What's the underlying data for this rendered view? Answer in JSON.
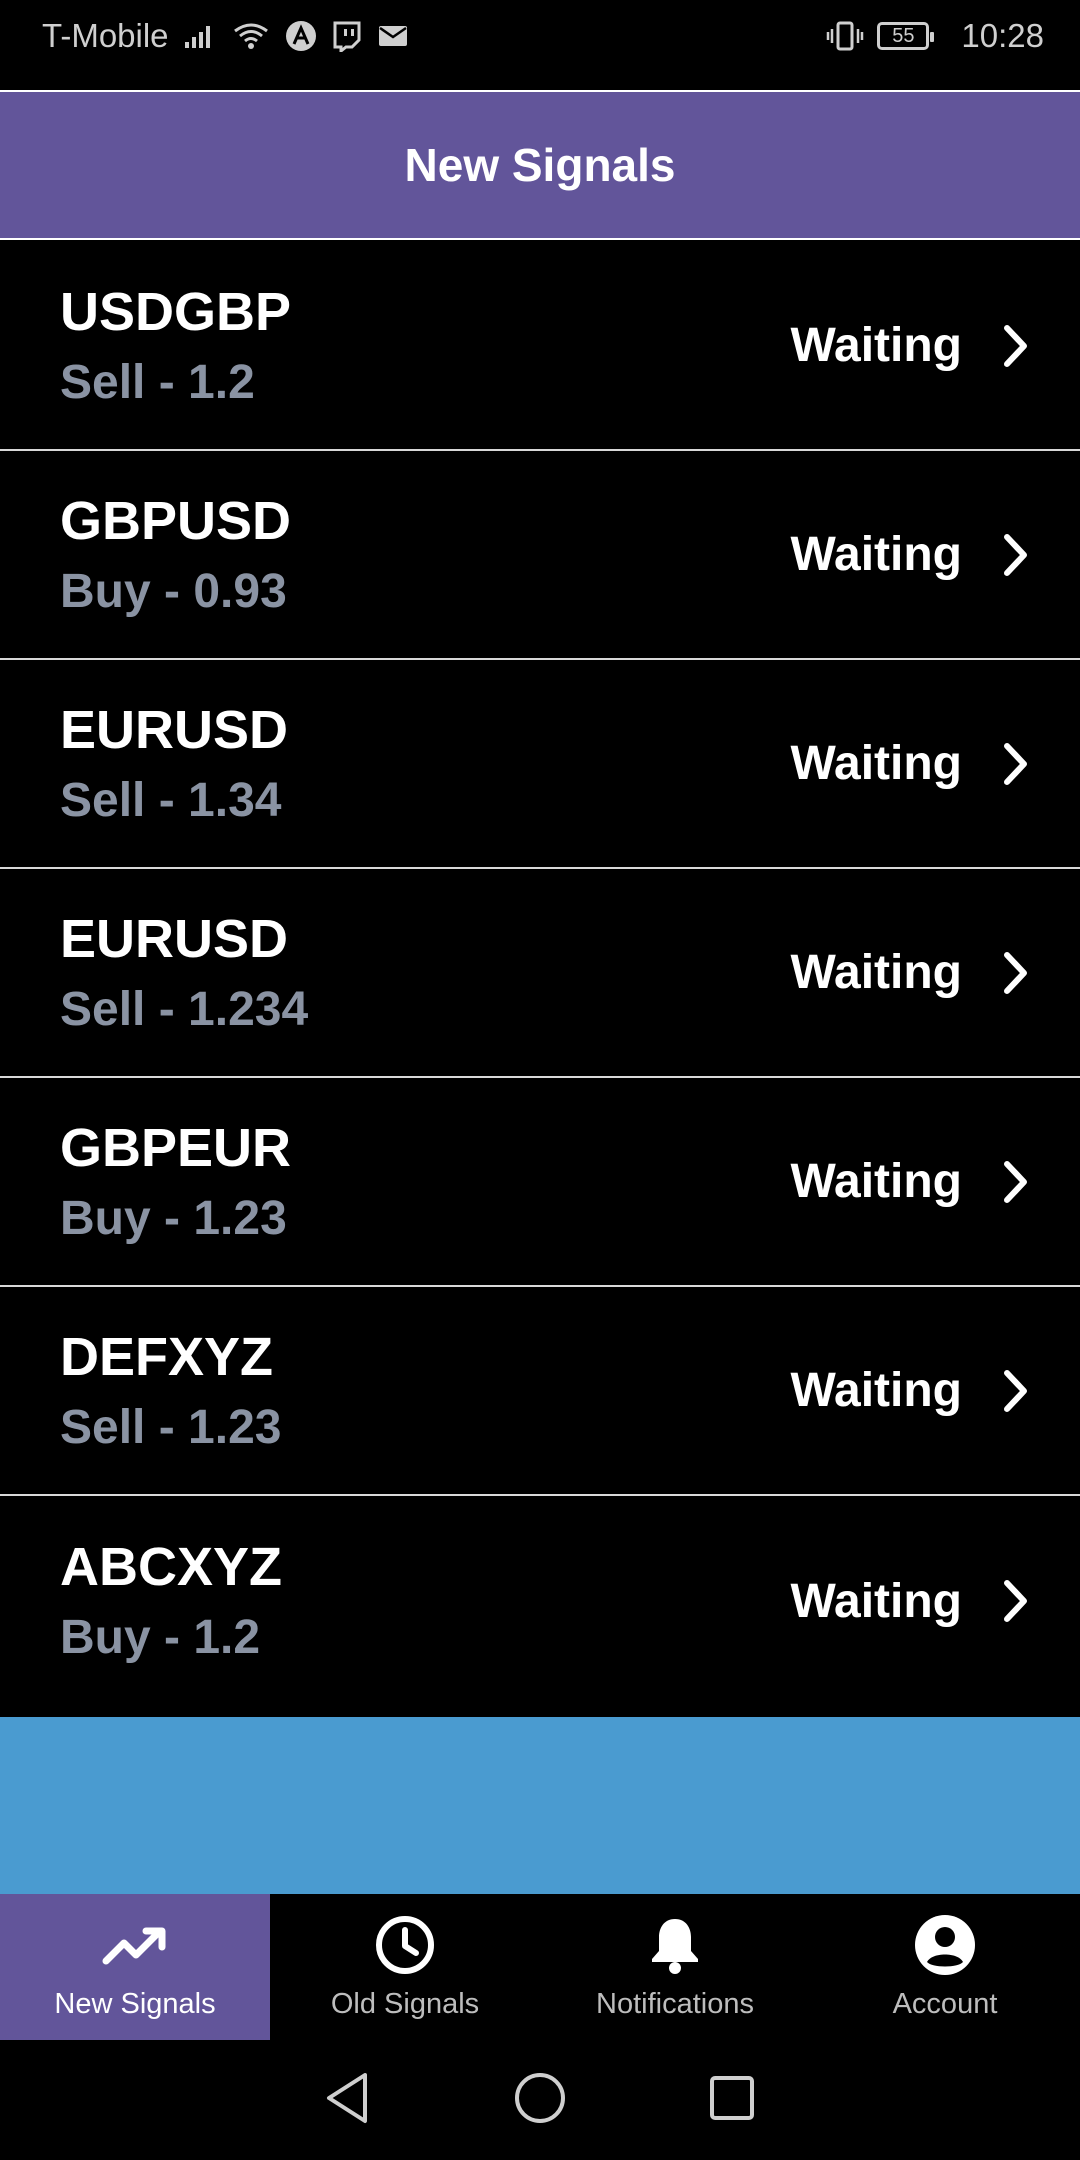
{
  "status_bar": {
    "carrier": "T-Mobile",
    "battery": "55",
    "time": "10:28"
  },
  "header": {
    "title": "New Signals"
  },
  "signals": [
    {
      "pair": "USDGBP",
      "detail": "Sell - 1.2",
      "status": "Waiting"
    },
    {
      "pair": "GBPUSD",
      "detail": "Buy - 0.93",
      "status": "Waiting"
    },
    {
      "pair": "EURUSD",
      "detail": "Sell - 1.34",
      "status": "Waiting"
    },
    {
      "pair": "EURUSD",
      "detail": "Sell - 1.234",
      "status": "Waiting"
    },
    {
      "pair": "GBPEUR",
      "detail": "Buy - 1.23",
      "status": "Waiting"
    },
    {
      "pair": "DEFXYZ",
      "detail": "Sell - 1.23",
      "status": "Waiting"
    },
    {
      "pair": "ABCXYZ",
      "detail": "Buy - 1.2",
      "status": "Waiting"
    }
  ],
  "bottom_nav": {
    "items": [
      {
        "label": "New Signals",
        "icon": "trending-up-icon",
        "active": true
      },
      {
        "label": "Old Signals",
        "icon": "clock-icon",
        "active": false
      },
      {
        "label": "Notifications",
        "icon": "bell-icon",
        "active": false
      },
      {
        "label": "Account",
        "icon": "account-circle-icon",
        "active": false
      }
    ]
  },
  "colors": {
    "header_bg": "#62559A",
    "banner_bg": "#4A9BD0",
    "muted_text": "#8a93a3"
  }
}
